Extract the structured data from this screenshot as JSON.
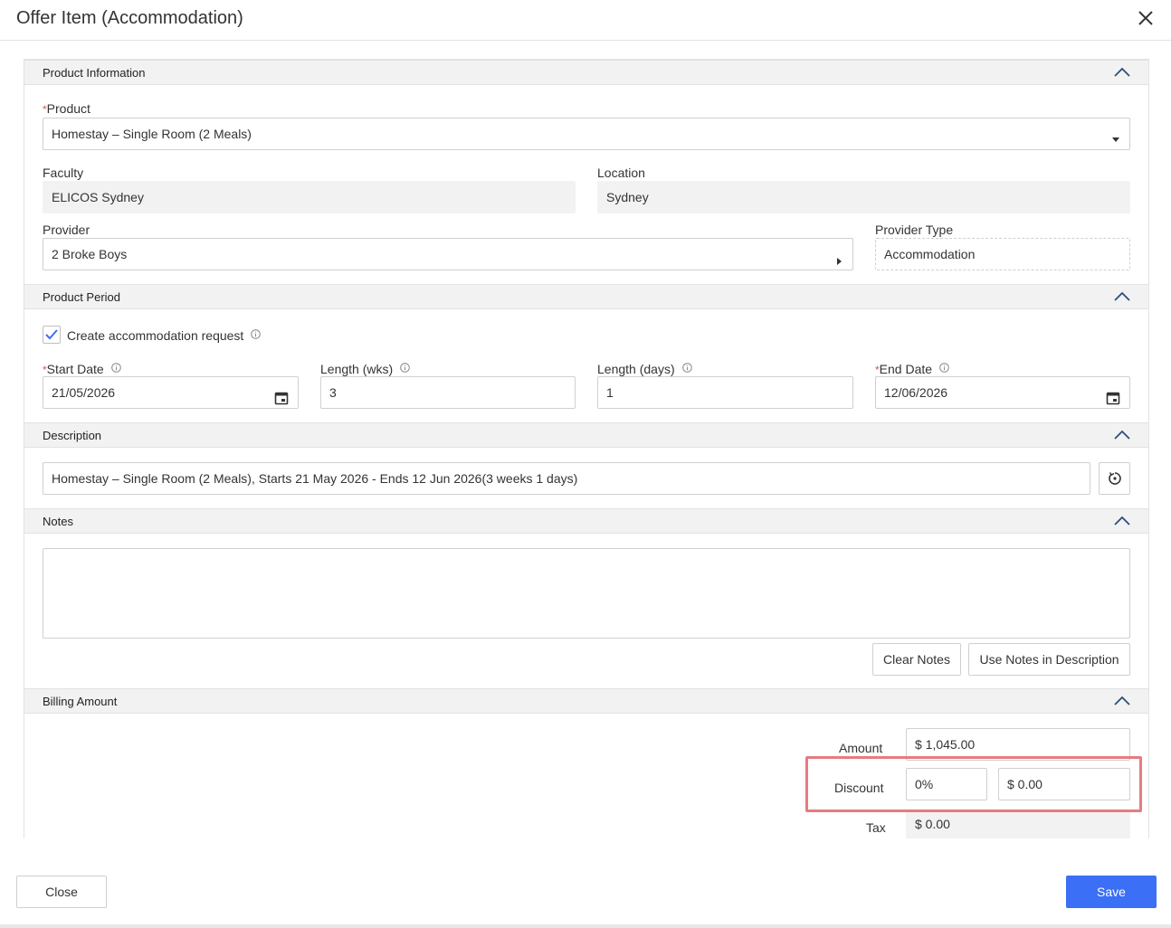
{
  "modal": {
    "title": "Offer Item (Accommodation)"
  },
  "sections": {
    "product_information": "Product Information",
    "product_period": "Product Period",
    "description": "Description",
    "notes": "Notes",
    "billing_amount": "Billing Amount"
  },
  "product": {
    "label": "Product",
    "required_mark": "*",
    "value": "Homestay – Single Room (2 Meals)"
  },
  "faculty": {
    "label": "Faculty",
    "value": "ELICOS Sydney"
  },
  "location": {
    "label": "Location",
    "value": "Sydney"
  },
  "provider": {
    "label": "Provider",
    "value": "2 Broke Boys"
  },
  "provider_type": {
    "label": "Provider Type",
    "value": "Accommodation"
  },
  "period": {
    "create_request_label": "Create accommodation request",
    "create_request_checked": true,
    "start_date": {
      "label": "Start Date",
      "required_mark": "*",
      "value": "21/05/2026"
    },
    "length_wks": {
      "label": "Length (wks)",
      "value": "3"
    },
    "length_days": {
      "label": "Length (days)",
      "value": "1"
    },
    "end_date": {
      "label": "End Date",
      "required_mark": "*",
      "value": "12/06/2026"
    }
  },
  "description": {
    "value": "Homestay – Single Room (2 Meals), Starts 21 May 2026 - Ends 12 Jun 2026(3 weeks 1 days)"
  },
  "notes": {
    "value": "",
    "clear_label": "Clear Notes",
    "use_in_description_label": "Use Notes in Description"
  },
  "billing": {
    "amount_label": "Amount",
    "amount_value": "$ 1,045.00",
    "discount_label": "Discount",
    "discount_percent": "0%",
    "discount_amount": "$ 0.00",
    "tax_label": "Tax",
    "tax_value": "$ 0.00"
  },
  "footer": {
    "close_label": "Close",
    "save_label": "Save"
  },
  "colors": {
    "primary": "#3b6ff5",
    "highlight": "#e57c80",
    "checkbox_check": "#3b6ff5"
  }
}
